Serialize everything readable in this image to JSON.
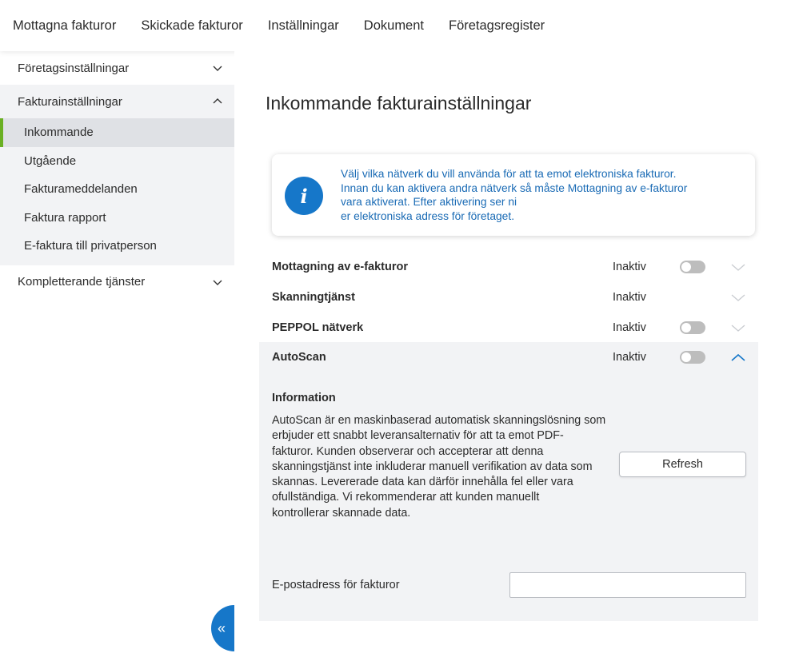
{
  "topnav": {
    "items": [
      "Mottagna fakturor",
      "Skickade fakturor",
      "Inställningar",
      "Dokument",
      "Företagsregister"
    ]
  },
  "sidebar": {
    "sections": [
      {
        "label": "Företagsinställningar",
        "open": false
      },
      {
        "label": "Fakturainställningar",
        "open": true
      },
      {
        "label": "Kompletterande tjänster",
        "open": false
      }
    ],
    "sub_items": [
      "Inkommande",
      "Utgående",
      "Fakturameddelanden",
      "Faktura rapport",
      "E-faktura till privatperson"
    ],
    "active_sub_item": "Inkommande",
    "collapse_icon": "«"
  },
  "main": {
    "title": "Inkommande fakturainställningar",
    "info_icon": "i",
    "info_lines": [
      "Välj vilka nätverk du vill använda för att ta emot elektroniska fakturor.",
      "Innan du kan aktivera andra nätverk så måste Mottagning av e-fakturor",
      "vara aktiverat. Efter aktivering ser ni",
      "er elektroniska adress för företaget."
    ],
    "rows": [
      {
        "name": "Mottagning av e-fakturor",
        "status": "Inaktiv",
        "has_toggle": true
      },
      {
        "name": "Skanningtjänst",
        "status": "Inaktiv",
        "has_toggle": false
      },
      {
        "name": "PEPPOL nätverk",
        "status": "Inaktiv",
        "has_toggle": true
      },
      {
        "name": "AutoScan",
        "status": "Inaktiv",
        "has_toggle": true
      }
    ],
    "expanded": {
      "heading": "Information",
      "paragraph_lines": [
        "AutoScan är en maskinbaserad automatisk skanningslösning som",
        "erbjuder ett snabbt leveransalternativ för att ta emot PDF-",
        "fakturor. Kunden observerar och accepterar att denna",
        "skanningstjänst inte inkluderar manuell verifikation av data som",
        "skannas. Levererade data kan därför innehålla fel eller vara",
        "ofullständiga. Vi rekommenderar att kunden manuellt",
        "kontrollerar skannade data."
      ],
      "refresh_label": "Refresh",
      "email_label": "E-postadress för fakturor",
      "email_value": ""
    },
    "colors": {
      "accent": "#1677c9",
      "active_marker": "#6ab023",
      "info_text": "#1a6bb5"
    }
  }
}
